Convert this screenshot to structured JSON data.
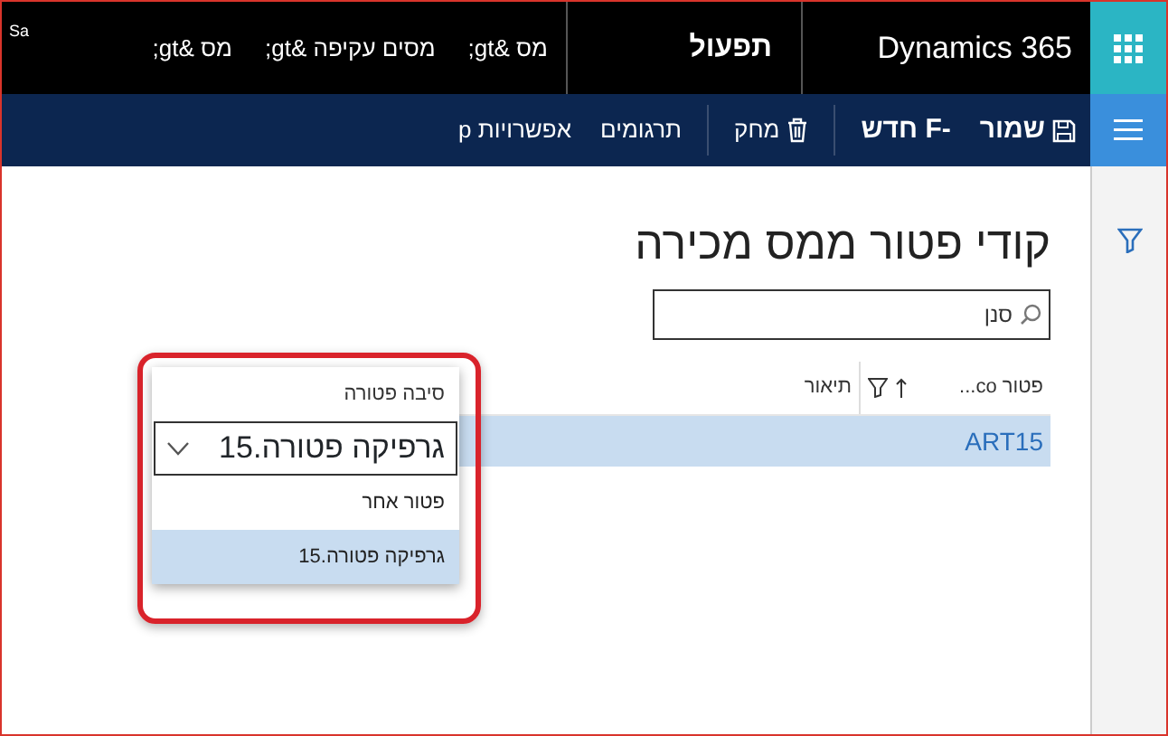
{
  "top_bar": {
    "app_name": "Dynamics 365",
    "module": "תפעול",
    "breadcrumb": [
      "מס &gt;",
      "מסים עקיפה &gt;",
      "מס &gt;"
    ],
    "company": "Sa"
  },
  "action_bar": {
    "actions": [
      {
        "label": "שמור",
        "kind": "save"
      },
      {
        "label": "-F חדש",
        "kind": "plain"
      },
      {
        "label": "מחק",
        "kind": "delete"
      },
      {
        "label": "תרגומים",
        "kind": "plain"
      },
      {
        "label": "אפשרויות p",
        "kind": "plain"
      }
    ]
  },
  "page": {
    "title": "קודי פטור ממס מכירה",
    "search": {
      "placeholder": "סנן"
    }
  },
  "grid": {
    "columns": [
      "פטור co...",
      "תיאור"
    ],
    "rows": [
      {
        "code": "ART15",
        "selected": true
      }
    ]
  },
  "dropdown": {
    "label": "סיבה פטורה",
    "value": "גרפיקה פטורה.15",
    "options": [
      {
        "label": "פטור אחר",
        "selected": false
      },
      {
        "label": "גרפיקה פטורה.15",
        "selected": true
      }
    ]
  }
}
